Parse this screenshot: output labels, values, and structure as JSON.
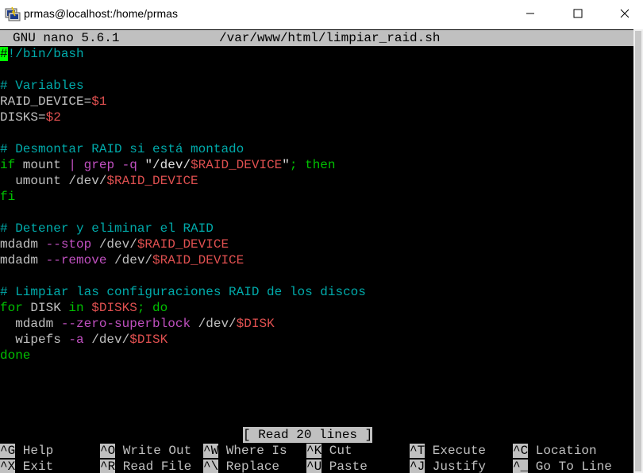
{
  "window": {
    "title": "prmas@localhost:/home/prmas"
  },
  "nano": {
    "version": "GNU nano 5.6.1",
    "filename": "/var/www/html/limpiar_raid.sh",
    "status": "[ Read 20 lines ]"
  },
  "code_lines": [
    [
      {
        "t": "#",
        "c": "cursor"
      },
      {
        "t": "!/bin/bash",
        "c": "c-comment"
      }
    ],
    [],
    [
      {
        "t": "# Variables",
        "c": "c-comment"
      }
    ],
    [
      {
        "t": "RAID_DEVICE=",
        "c": "c-plain"
      },
      {
        "t": "$1",
        "c": "c-var"
      }
    ],
    [
      {
        "t": "DISKS=",
        "c": "c-plain"
      },
      {
        "t": "$2",
        "c": "c-var"
      }
    ],
    [],
    [
      {
        "t": "# Desmontar RAID si está montado",
        "c": "c-comment"
      }
    ],
    [
      {
        "t": "if",
        "c": "c-green"
      },
      {
        "t": " mount ",
        "c": "c-plain"
      },
      {
        "t": "|",
        "c": "c-magenta"
      },
      {
        "t": " grep ",
        "c": "c-magenta"
      },
      {
        "t": "-q",
        "c": "c-magenta"
      },
      {
        "t": " \"/dev/",
        "c": "c-str"
      },
      {
        "t": "$RAID_DEVICE",
        "c": "c-var"
      },
      {
        "t": "\"",
        "c": "c-str"
      },
      {
        "t": "; then",
        "c": "c-green"
      }
    ],
    [
      {
        "t": "  umount /dev/",
        "c": "c-plain"
      },
      {
        "t": "$RAID_DEVICE",
        "c": "c-var"
      }
    ],
    [
      {
        "t": "fi",
        "c": "c-green"
      }
    ],
    [],
    [
      {
        "t": "# Detener y eliminar el RAID",
        "c": "c-comment"
      }
    ],
    [
      {
        "t": "mdadm ",
        "c": "c-plain"
      },
      {
        "t": "--stop",
        "c": "c-magenta"
      },
      {
        "t": " /dev/",
        "c": "c-plain"
      },
      {
        "t": "$RAID_DEVICE",
        "c": "c-var"
      }
    ],
    [
      {
        "t": "mdadm ",
        "c": "c-plain"
      },
      {
        "t": "--remove",
        "c": "c-magenta"
      },
      {
        "t": " /dev/",
        "c": "c-plain"
      },
      {
        "t": "$RAID_DEVICE",
        "c": "c-var"
      }
    ],
    [],
    [
      {
        "t": "# Limpiar las configuraciones RAID de los discos",
        "c": "c-comment"
      }
    ],
    [
      {
        "t": "for",
        "c": "c-green"
      },
      {
        "t": " DISK ",
        "c": "c-plain"
      },
      {
        "t": "in",
        "c": "c-green"
      },
      {
        "t": " ",
        "c": "c-plain"
      },
      {
        "t": "$DISKS",
        "c": "c-var"
      },
      {
        "t": "; do",
        "c": "c-green"
      }
    ],
    [
      {
        "t": "  mdadm ",
        "c": "c-plain"
      },
      {
        "t": "--zero-superblock",
        "c": "c-magenta"
      },
      {
        "t": " /dev/",
        "c": "c-plain"
      },
      {
        "t": "$DISK",
        "c": "c-var"
      }
    ],
    [
      {
        "t": "  wipefs ",
        "c": "c-plain"
      },
      {
        "t": "-a",
        "c": "c-magenta"
      },
      {
        "t": " /dev/",
        "c": "c-plain"
      },
      {
        "t": "$DISK",
        "c": "c-var"
      }
    ],
    [
      {
        "t": "done",
        "c": "c-green"
      }
    ]
  ],
  "shortcuts": [
    {
      "key": "^G",
      "label": " Help",
      "row": 0,
      "col": 0
    },
    {
      "key": "^X",
      "label": " Exit",
      "row": 1,
      "col": 0
    },
    {
      "key": "^O",
      "label": " Write Out",
      "row": 0,
      "col": 1
    },
    {
      "key": "^R",
      "label": " Read File",
      "row": 1,
      "col": 1
    },
    {
      "key": "^W",
      "label": " Where Is",
      "row": 0,
      "col": 2
    },
    {
      "key": "^\\",
      "label": " Replace",
      "row": 1,
      "col": 2
    },
    {
      "key": "^K",
      "label": " Cut",
      "row": 0,
      "col": 3
    },
    {
      "key": "^U",
      "label": " Paste",
      "row": 1,
      "col": 3
    },
    {
      "key": "^T",
      "label": " Execute",
      "row": 0,
      "col": 4
    },
    {
      "key": "^J",
      "label": " Justify",
      "row": 1,
      "col": 4
    },
    {
      "key": "^C",
      "label": " Location",
      "row": 0,
      "col": 5
    },
    {
      "key": "^_",
      "label": " Go To Line",
      "row": 1,
      "col": 5
    }
  ],
  "colors": {
    "background": "#000000",
    "header_bg": "#c0c0c0",
    "comment": "#00aaaa",
    "keyword": "#00c000",
    "variable": "#e05050",
    "option": "#c050c0",
    "cursor": "#00ff00"
  },
  "icons": {
    "app": "putty-terminal-icon",
    "minimize": "minimize-icon",
    "maximize": "maximize-icon",
    "close": "close-icon"
  }
}
